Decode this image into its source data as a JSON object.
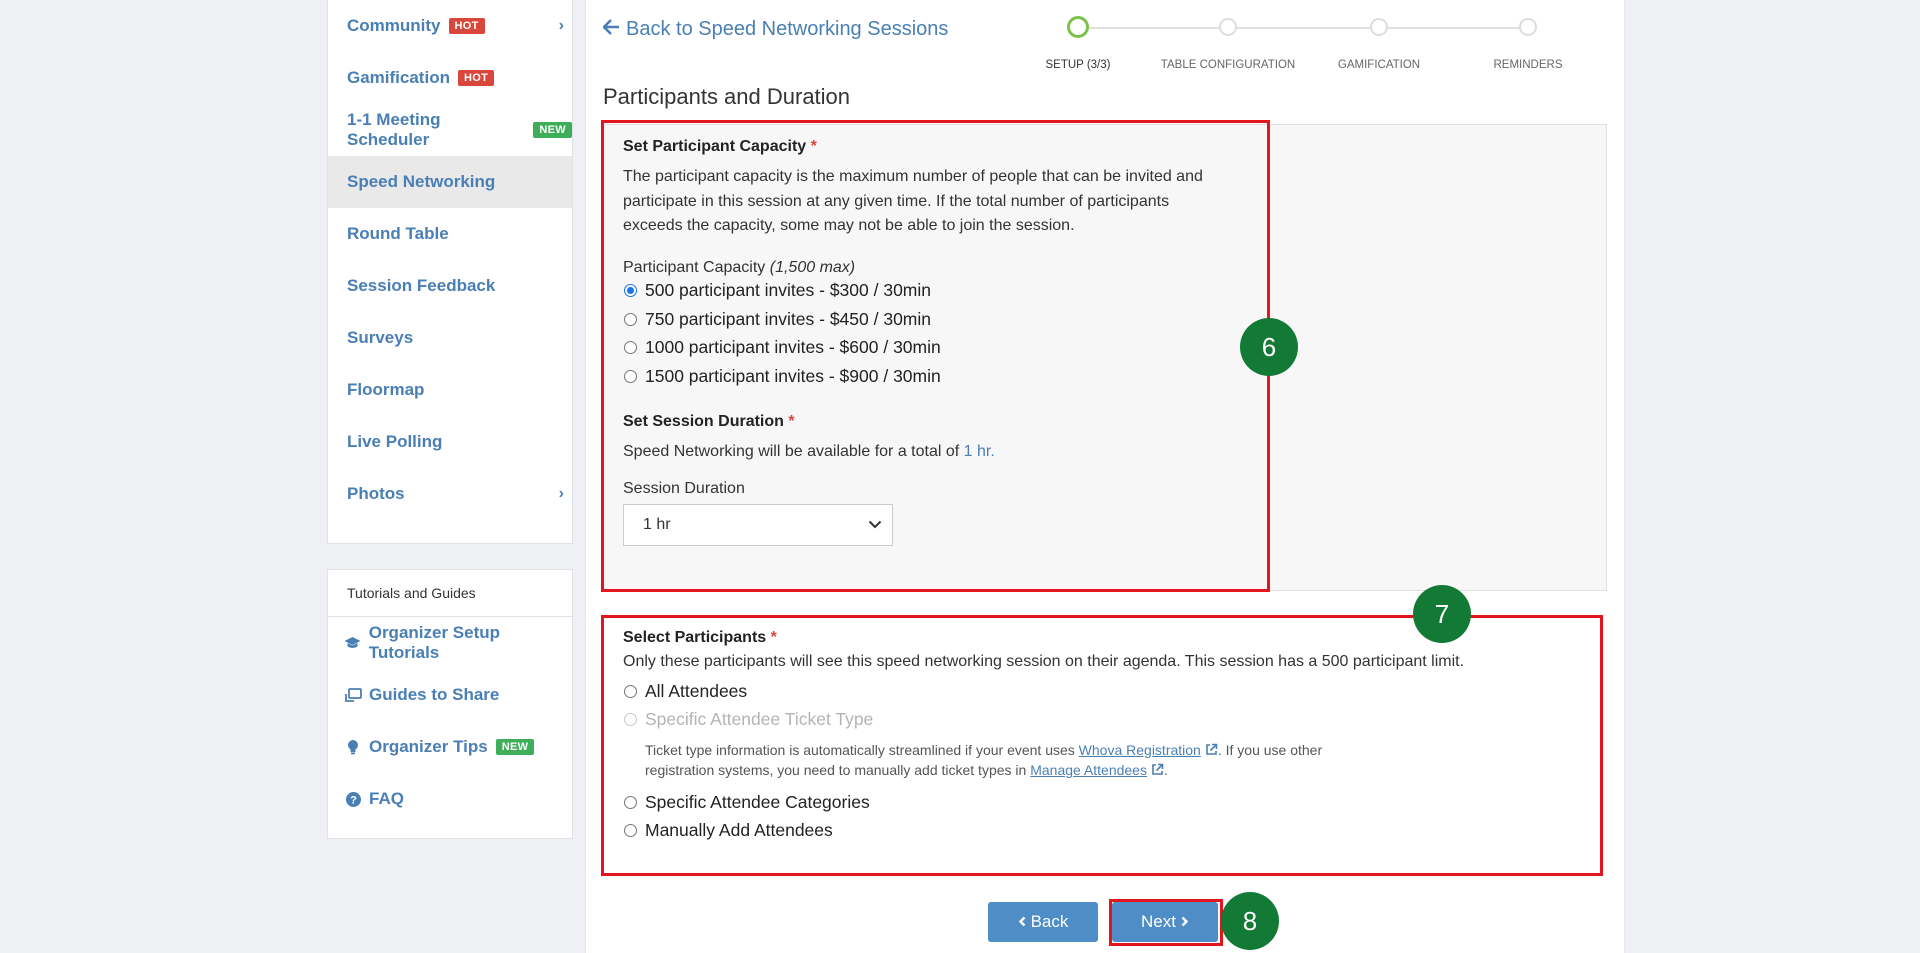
{
  "sidebar": {
    "items": [
      {
        "label": "Community",
        "badge": "HOT"
      },
      {
        "label": "Gamification",
        "badge": "HOT"
      },
      {
        "label": "1-1 Meeting Scheduler",
        "badge": "NEW"
      },
      {
        "label": "Speed Networking"
      },
      {
        "label": "Round Table"
      },
      {
        "label": "Session Feedback"
      },
      {
        "label": "Surveys"
      },
      {
        "label": "Floormap"
      },
      {
        "label": "Live Polling"
      },
      {
        "label": "Photos"
      }
    ],
    "guides_title": "Tutorials and Guides",
    "guides": [
      {
        "label": "Organizer Setup Tutorials",
        "icon": "graduation-cap-icon"
      },
      {
        "label": "Guides to Share",
        "icon": "share-screen-icon"
      },
      {
        "label": "Organizer Tips",
        "badge": "NEW",
        "icon": "lightbulb-icon"
      },
      {
        "label": "FAQ",
        "icon": "question-circle-icon"
      }
    ]
  },
  "header": {
    "back_link": "Back to Speed Networking Sessions",
    "steps": [
      "SETUP (3/3)",
      "TABLE CONFIGURATION",
      "GAMIFICATION",
      "REMINDERS"
    ],
    "section_title": "Participants and Duration"
  },
  "capacity": {
    "heading": "Set Participant Capacity",
    "required_mark": "*",
    "description": "The participant capacity is the maximum number of people that can be invited and participate in this session at any given time. If the total number of participants exceeds the capacity, some may not be able to join the session.",
    "field_label": "Participant Capacity",
    "field_hint": "(1,500 max)",
    "options": [
      "500 participant invites - $300 / 30min",
      "750 participant invites - $450 / 30min",
      "1000 participant invites - $600 / 30min",
      "1500 participant invites - $900 / 30min"
    ]
  },
  "duration": {
    "heading": "Set Session Duration",
    "required_mark": "*",
    "text_prefix": "Speed Networking will be available for a total of",
    "text_value": "1 hr.",
    "field_label": "Session Duration",
    "selected": "1 hr"
  },
  "participants": {
    "heading": "Select Participants",
    "required_mark": "*",
    "description": "Only these participants will see this speed networking session on their agenda. This session has a 500 participant limit.",
    "options": [
      "All Attendees",
      "Specific Attendee Ticket Type",
      "Specific Attendee Categories",
      "Manually Add Attendees"
    ],
    "helper_1": "Ticket type information is automatically streamlined if your event uses",
    "helper_link_1": "Whova Registration",
    "helper_2": ". If you use other registration systems, you need to manually add ticket types in",
    "helper_link_2": "Manage Attendees",
    "helper_3": "."
  },
  "footer": {
    "back_label": "Back",
    "next_label": "Next"
  },
  "markers": [
    "6",
    "7",
    "8"
  ],
  "colors": {
    "accent": "#4a7fb5",
    "highlight": "#e3161d",
    "marker": "#127a34",
    "hot": "#d9463b",
    "new": "#3fae5a"
  }
}
